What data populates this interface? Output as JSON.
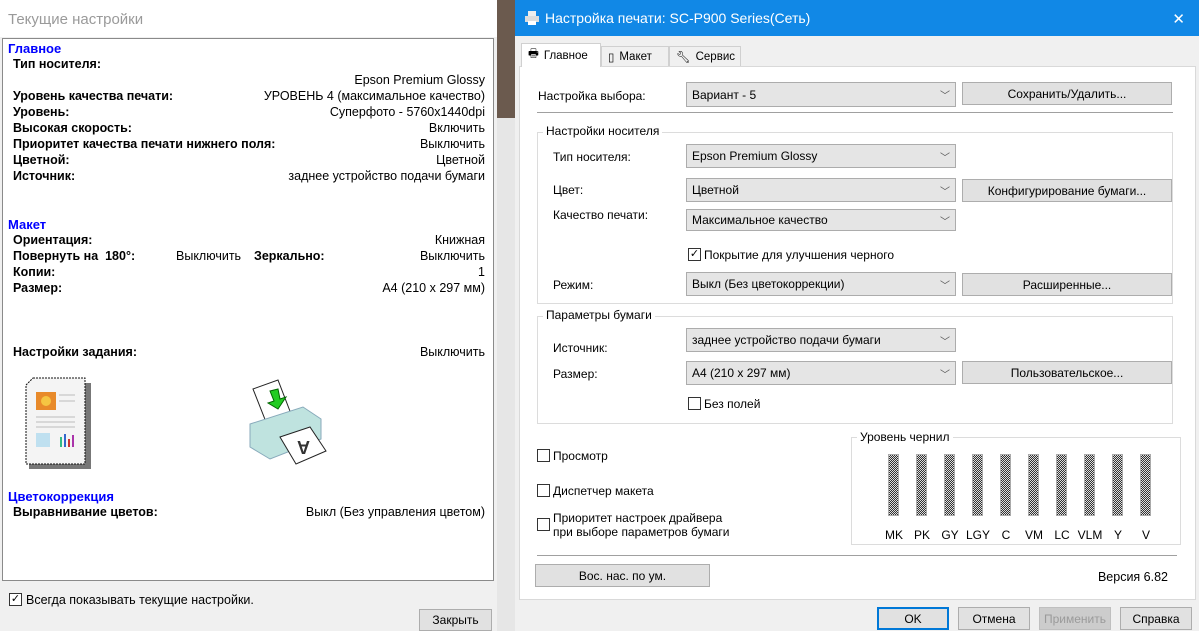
{
  "left_window": {
    "title": "Текущие настройки",
    "sections": {
      "main": {
        "title": "Главное",
        "media_type_label": "Тип носителя:",
        "media_type_value": "Epson Premium Glossy",
        "quality_label": "Уровень качества печати:",
        "quality_value": "УРОВЕНЬ 4 (максимальное качество)",
        "level_label": "Уровень:",
        "level_value": "Суперфото - 5760x1440dpi",
        "high_speed_label": "Высокая скорость:",
        "high_speed_value": "Включить",
        "bottom_priority_label": "Приоритет качества печати нижнего поля:",
        "bottom_priority_value": "Выключить",
        "color_label": "Цветной:",
        "color_value": "Цветной",
        "source_label": "Источник:",
        "source_value": "заднее устройство подачи бумаги"
      },
      "layout": {
        "title": "Макет",
        "orientation_label": "Ориентация:",
        "orientation_value": "Книжная",
        "rotate_label": "Повернуть на  180°:",
        "rotate_value": "Выключить",
        "mirror_label": "Зеркально:",
        "mirror_value": "Выключить",
        "copies_label": "Копии:",
        "copies_value": "1",
        "size_label": "Размер:",
        "size_value": "A4 (210 x 297 мм)",
        "job_label": "Настройки задания:",
        "job_value": "Выключить"
      },
      "color": {
        "title": "Цветокоррекция",
        "align_label": "Выравнивание цветов:",
        "align_value": "Выкл (Без управления цветом)"
      }
    },
    "always_show_label": "Всегда показывать текущие настройки.",
    "always_show_checked": true,
    "close_button": "Закрыть"
  },
  "right_window": {
    "title": "Настройка печати: SC-P900 Series(Сеть)",
    "close_glyph": "✕",
    "tabs": [
      {
        "label": "Главное"
      },
      {
        "label": "Макет"
      },
      {
        "label": "Сервис"
      }
    ],
    "preset_label": "Настройка выбора:",
    "preset_value": "Вариант - 5",
    "save_delete_button": "Сохранить/Удалить...",
    "media_group": {
      "title": "Настройки носителя",
      "media_type_label": "Тип носителя:",
      "media_type_value": "Epson Premium Glossy",
      "color_label": "Цвет:",
      "color_value": "Цветной",
      "paper_config_button": "Конфигурирование бумаги...",
      "quality_label": "Качество печати:",
      "quality_value": "Максимальное качество",
      "black_enhance_label": "Покрытие для улучшения черного",
      "black_enhance_checked": true,
      "mode_label": "Режим:",
      "mode_value": "Выкл (Без цветокоррекции)",
      "advanced_button": "Расширенные..."
    },
    "paper_group": {
      "title": "Параметры бумаги",
      "source_label": "Источник:",
      "source_value": "заднее устройство подачи бумаги",
      "size_label": "Размер:",
      "size_value": "A4 (210 x 297 мм)",
      "custom_button": "Пользовательское...",
      "borderless_label": "Без полей",
      "borderless_checked": false
    },
    "preview_label": "Просмотр",
    "layout_manager_label": "Диспетчер макета",
    "driver_priority_line1": "Приоритет настроек драйвера",
    "driver_priority_line2": "при выборе параметров бумаги",
    "ink": {
      "title": "Уровень чернил",
      "colors": [
        "MK",
        "PK",
        "GY",
        "LGY",
        "C",
        "VM",
        "LC",
        "VLM",
        "Y",
        "V"
      ]
    },
    "restore_defaults_button": "Вос. нас. по ум.",
    "version": "Версия 6.82",
    "ok_button": "OK",
    "cancel_button": "Отмена",
    "apply_button": "Применить",
    "help_button": "Справка"
  }
}
